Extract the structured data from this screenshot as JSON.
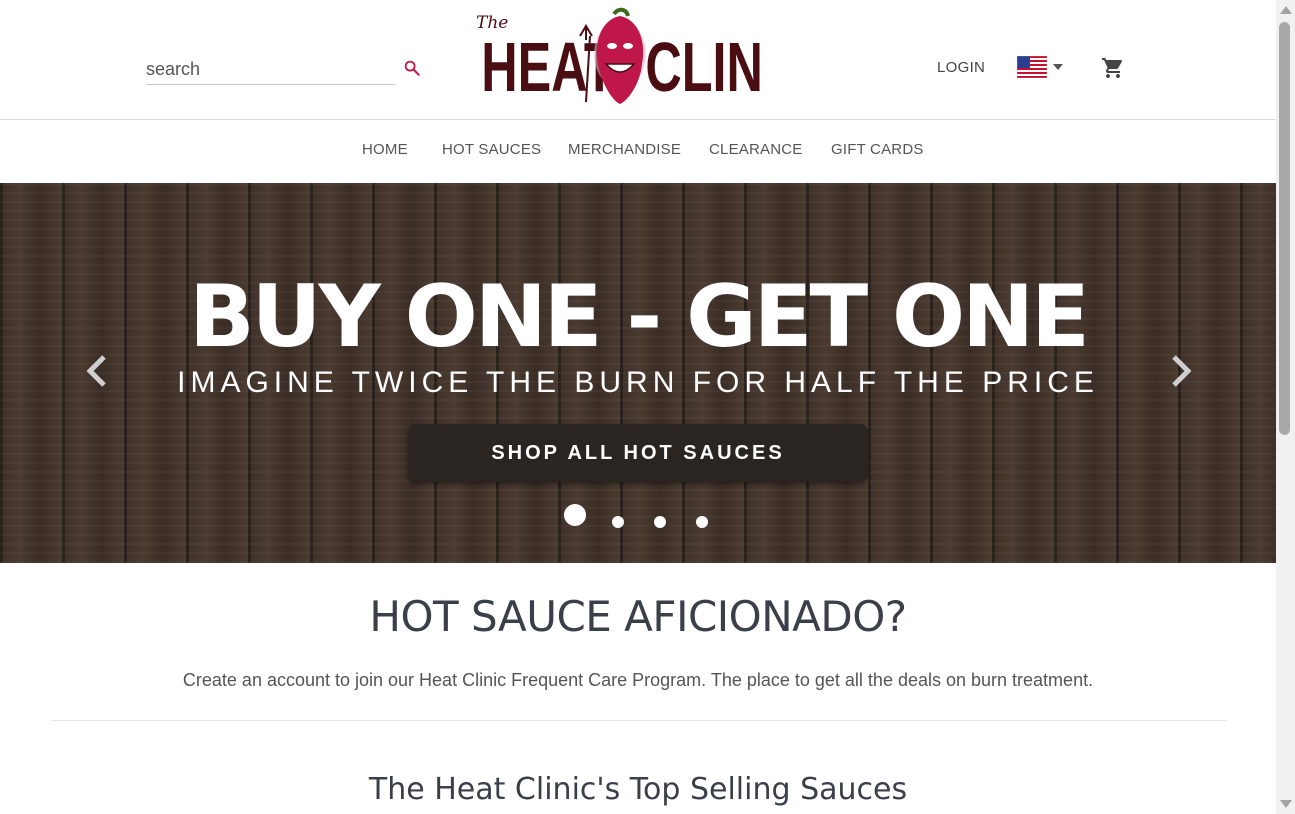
{
  "header": {
    "search_placeholder": "search",
    "logo_text": {
      "the": "The",
      "heat": "HEAT",
      "clinic": "CLINIC"
    },
    "login_label": "LOGIN",
    "flag_icon": "us-flag-icon",
    "cart_icon": "cart-icon"
  },
  "nav": {
    "items": [
      {
        "label": "HOME"
      },
      {
        "label": "HOT SAUCES"
      },
      {
        "label": "MERCHANDISE"
      },
      {
        "label": "CLEARANCE"
      },
      {
        "label": "GIFT CARDS"
      }
    ]
  },
  "hero": {
    "headline": "BUY ONE - GET ONE",
    "subline": "IMAGINE TWICE THE BURN FOR HALF THE PRICE",
    "cta_label": "SHOP ALL HOT SAUCES",
    "slide_count": 4,
    "active_slide": 1
  },
  "promo": {
    "title": "HOT SAUCE AFICIONADO?",
    "text": "Create an account to join our Heat Clinic Frequent Care Program. The place to get all the deals on burn treatment."
  },
  "top_selling": {
    "title": "The Heat Clinic's Top Selling Sauces"
  },
  "colors": {
    "accent": "#c0174a",
    "logo_dark": "#4a0d12",
    "text_dark": "#3a3f4a",
    "cta_bg": "#2b2522"
  }
}
